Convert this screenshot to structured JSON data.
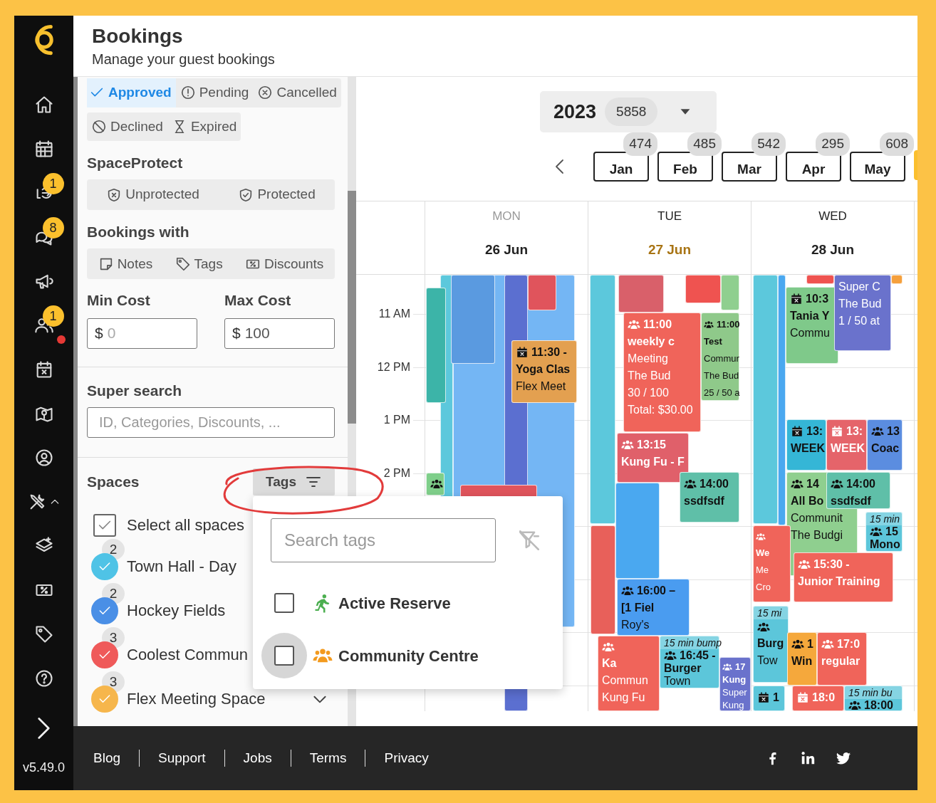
{
  "nav": [
    {
      "alert": false
    },
    {
      "alert": false
    },
    {
      "alert": false,
      "badge": "1"
    },
    {
      "alert": false,
      "badge": "8"
    },
    {
      "alert": false
    },
    {
      "alert": true,
      "badge": "1"
    },
    {
      "alert": false
    },
    {
      "alert": false
    },
    {
      "alert": false
    },
    {
      "alert": false,
      "expanded": true
    },
    {
      "alert": false
    },
    {
      "alert": false
    },
    {
      "alert": false
    },
    {
      "alert": false
    }
  ],
  "version": "v5.49.0",
  "header": {
    "title": "Bookings",
    "subtitle": "Manage your guest bookings"
  },
  "status_filters": [
    {
      "label": "Approved",
      "selected": true
    },
    {
      "label": "Pending",
      "selected": false
    },
    {
      "label": "Cancelled",
      "selected": false
    },
    {
      "label": "Declined",
      "selected": false
    },
    {
      "label": "Expired",
      "selected": false
    }
  ],
  "space_protect": {
    "title": "SpaceProtect",
    "options": [
      {
        "label": "Unprotected",
        "selected": false
      },
      {
        "label": "Protected",
        "selected": false
      }
    ]
  },
  "bookings_with": {
    "title": "Bookings with",
    "options": [
      {
        "label": "Notes",
        "selected": false
      },
      {
        "label": "Tags",
        "selected": false
      },
      {
        "label": "Discounts",
        "selected": false
      }
    ]
  },
  "min_cost": {
    "label": "Min Cost",
    "prefix": "$",
    "placeholder": "0"
  },
  "max_cost": {
    "label": "Max Cost",
    "prefix": "$",
    "value": "100"
  },
  "super_search": {
    "title": "Super search",
    "placeholder": "ID, Categories, Discounts, ..."
  },
  "spaces": {
    "title": "Spaces",
    "tags_button": "Tags",
    "select_all": {
      "label": "Select all spaces",
      "checked": true
    },
    "items": [
      {
        "name": "Town Hall - Day",
        "count": "2",
        "color": "#4fc3e6",
        "checked": true,
        "expandable": false
      },
      {
        "name": "Hockey Fields",
        "count": "2",
        "color": "#4a8fe6",
        "checked": true,
        "expandable": false
      },
      {
        "name": "Coolest Commun",
        "count": "3",
        "color": "#ef5a5a",
        "checked": true,
        "expandable": false
      },
      {
        "name": "Flex Meeting Space",
        "count": "3",
        "color": "#f6b64c",
        "checked": true,
        "expandable": true
      }
    ]
  },
  "tags_popup": {
    "placeholder": "Search tags",
    "items": [
      {
        "label": "Active Reserve",
        "color": "#4caf50",
        "kind": "runner",
        "checked": false,
        "focused": false
      },
      {
        "label": "Community Centre",
        "color": "#f39a1e",
        "kind": "group",
        "checked": false,
        "focused": true
      }
    ]
  },
  "year": {
    "label": "2023",
    "count": "5858"
  },
  "months": [
    {
      "label": "Jan",
      "count": "474",
      "selected": false
    },
    {
      "label": "Feb",
      "count": "485",
      "selected": false
    },
    {
      "label": "Mar",
      "count": "542",
      "selected": false
    },
    {
      "label": "Apr",
      "count": "295",
      "selected": false
    },
    {
      "label": "May",
      "count": "608",
      "selected": false
    },
    {
      "selected": true
    }
  ],
  "hours": [
    "11 AM",
    "12 PM",
    "1 PM",
    "2 PM"
  ],
  "days": [
    {
      "name": "MON",
      "date": "26 Jun",
      "past": true,
      "today": false,
      "events": [
        {
          "color": "#5cc8dc"
        },
        {
          "color": "#74b6f4"
        },
        {
          "color": "#3cb4a8"
        },
        {
          "color": "#5a9ae0"
        },
        {
          "color": "#5b6fd0"
        },
        {
          "color": "#e0545c"
        },
        {
          "color": "#e3a050",
          "kind": "cancelled",
          "time": "11:30 -",
          "title": "Yoga Clas",
          "details": [
            "Flex Meet"
          ]
        },
        {
          "color": "#7fcf8a",
          "kind": "group"
        },
        {
          "color": "#e0545c"
        }
      ]
    },
    {
      "name": "TUE",
      "date": "27 Jun",
      "past": false,
      "today": true,
      "events": [
        {
          "color": "#5cc8dc"
        },
        {
          "color": "#4aa8f0"
        },
        {
          "color": "#d9606a"
        },
        {
          "color": "#ef5350"
        },
        {
          "color": "#8fcf8f"
        },
        {
          "color": "#f0645a",
          "kind": "group",
          "time": "11:00",
          "title": "weekly c",
          "details": [
            "Meeting",
            "The Bud",
            "30 / 100",
            "Total: $30.00"
          ]
        },
        {
          "color": "#8fc98a",
          "kind": "group",
          "time": "11:00",
          "title": "Test",
          "details": [
            "Commur",
            "The Bud",
            "25 / 50 a"
          ]
        },
        {
          "color": "#e0606a",
          "kind": "group",
          "time": "13:15",
          "title": "Kung Fu - F"
        },
        {
          "color": "#5fbfa8",
          "kind": "group",
          "time": "14:00",
          "title": "ssdfsdf"
        },
        {
          "color": "#e8605a"
        },
        {
          "color": "#4a9cf0",
          "kind": "group",
          "time": "16:00 –",
          "title": "[1 Fiel",
          "details": [
            "Roy's"
          ]
        },
        {
          "color": "#5cc6da",
          "kind": "group",
          "note": "15 min bump",
          "time": "16:45 -",
          "title": "Burger",
          "details": [
            "Town"
          ]
        },
        {
          "color": "#f0645a",
          "kind": "group",
          "title": "Ka",
          "details": [
            "Commun",
            "Kung Fu"
          ]
        },
        {
          "color": "#6a72cc",
          "kind": "group",
          "time": "17",
          "title": "Kung",
          "details": [
            "Super",
            "Kung"
          ]
        }
      ]
    },
    {
      "name": "WED",
      "date": "28 Jun",
      "past": false,
      "today": false,
      "events": [
        {
          "color": "#5cc8dc"
        },
        {
          "color": "#4aa8f0"
        },
        {
          "color": "#ef5350"
        },
        {
          "color": "#f5a03c"
        },
        {
          "color": "#7fc98a",
          "kind": "cancelled",
          "time": "10:3",
          "title": "Tania Y",
          "details": [
            "Commu"
          ]
        },
        {
          "color": "#6a72cc",
          "details": [
            "Super C",
            "The Bud",
            "1 / 50 at"
          ]
        },
        {
          "color": "#35b6d6",
          "kind": "cancelled",
          "time": "13:",
          "title": "WEEK"
        },
        {
          "color": "#e5646a",
          "kind": "cancelled",
          "time": "13:",
          "title": "WEEK"
        },
        {
          "color": "#5b8de0",
          "kind": "group",
          "time": "13",
          "title": "Coac"
        },
        {
          "color": "#8fcf8f",
          "kind": "group",
          "time": "14",
          "title": "All Bo",
          "details": [
            "Communit",
            "The Budgi"
          ]
        },
        {
          "color": "#5fbfa8",
          "kind": "group",
          "time": "14:00",
          "title": "ssdfsdf"
        },
        {
          "color": "#5cc6da",
          "kind": "group",
          "note": "15 min",
          "time": "15",
          "title": "Mono"
        },
        {
          "color": "#f0645a",
          "kind": "group",
          "title": "We",
          "details": [
            "Me",
            "Cro"
          ]
        },
        {
          "color": "#f0645a",
          "kind": "group",
          "time": "15:30 -",
          "title": "Junior Training"
        },
        {
          "color": "#5cc6da",
          "kind": "group",
          "note": "15 mi",
          "title": "Burg",
          "details": [
            "Tow"
          ]
        },
        {
          "color": "#f5a83c",
          "kind": "group",
          "time": "1",
          "title": "Win"
        },
        {
          "color": "#f0645a",
          "kind": "group",
          "time": "17:0",
          "title": "regular"
        },
        {
          "color": "#5cc6da",
          "kind": "cancelled",
          "time": "1"
        },
        {
          "color": "#f0645a",
          "kind": "cancelled",
          "time": "18:0"
        },
        {
          "color": "#5cc6da",
          "kind": "group",
          "note": "15 min bu",
          "time": "18:00"
        }
      ]
    }
  ],
  "footer": {
    "links": [
      "Blog",
      "Support",
      "Jobs",
      "Terms",
      "Privacy"
    ]
  }
}
